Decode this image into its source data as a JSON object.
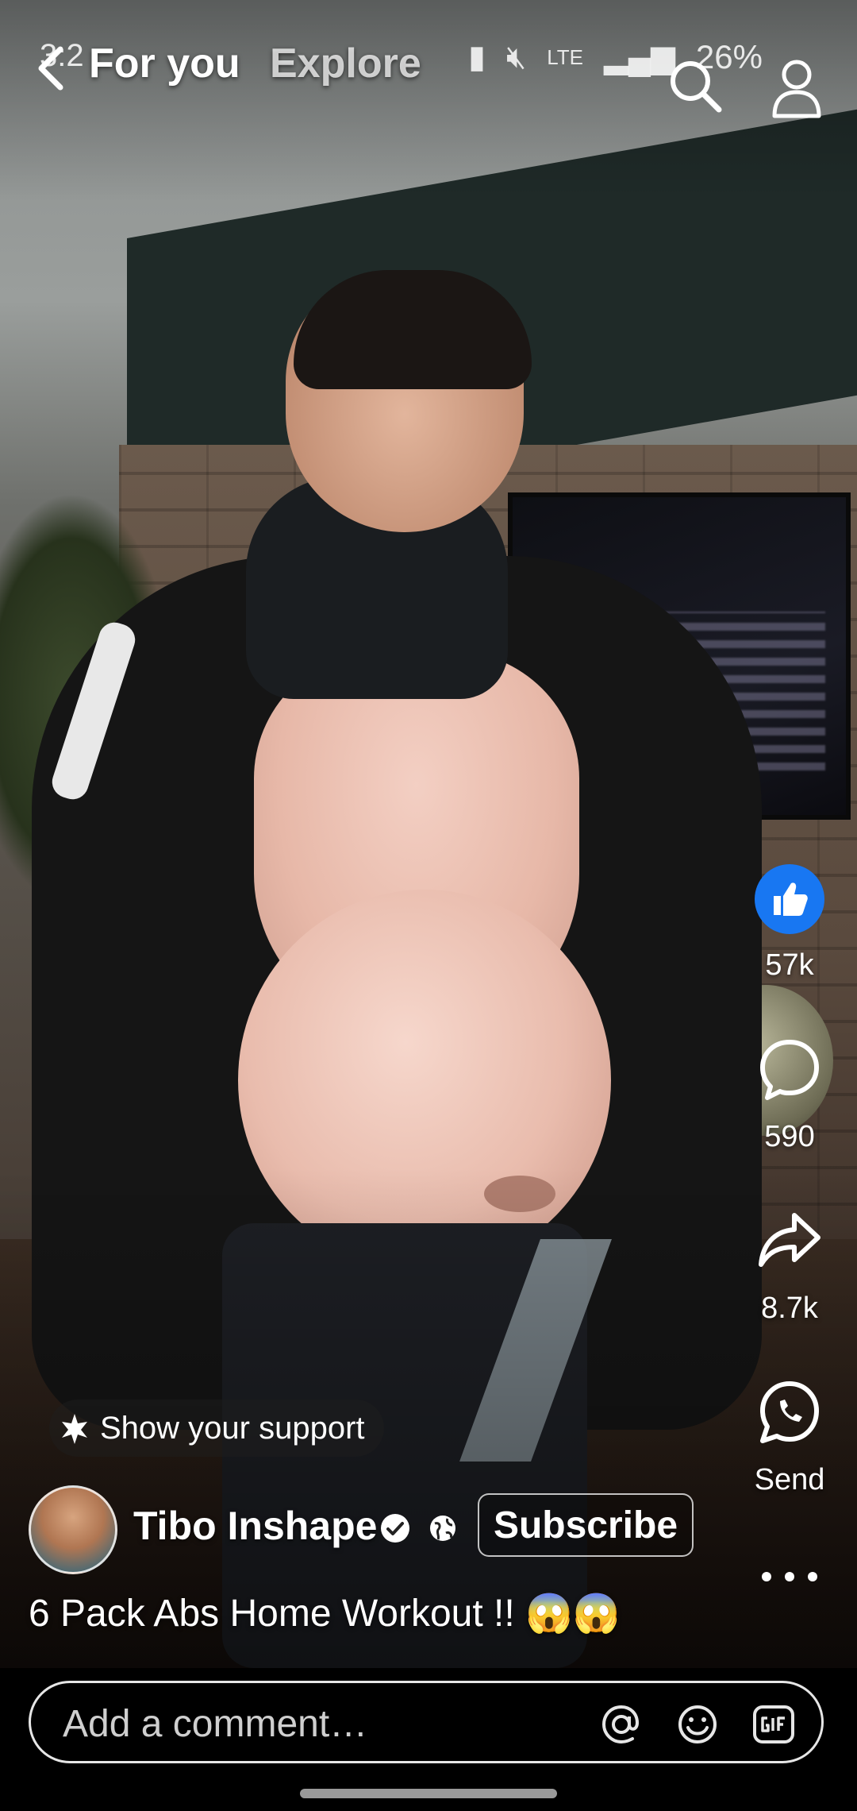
{
  "status_bar": {
    "time": "3:2",
    "network": "LTE",
    "battery": "26%"
  },
  "header": {
    "tabs": [
      "For you",
      "Explore"
    ],
    "active_tab": "For you"
  },
  "actions": {
    "likes": "57k",
    "comments": "590",
    "shares": "8.7k",
    "send_label": "Send"
  },
  "support": {
    "label": "Show your support"
  },
  "channel": {
    "name": "Tibo Inshape",
    "subscribe_label": "Subscribe"
  },
  "video": {
    "caption": "6 Pack Abs Home Workout !! 😱😱"
  },
  "comment": {
    "placeholder": "Add a comment…"
  },
  "colors": {
    "like_blue": "#1877f2",
    "background": "#000000"
  },
  "icons": [
    "back-icon",
    "search-icon",
    "profile-icon",
    "thumbs-up-icon",
    "comment-icon",
    "share-icon",
    "whatsapp-icon",
    "more-icon",
    "sparkle-icon",
    "verified-icon",
    "globe-icon",
    "at-icon",
    "emoji-icon",
    "gif-icon"
  ]
}
